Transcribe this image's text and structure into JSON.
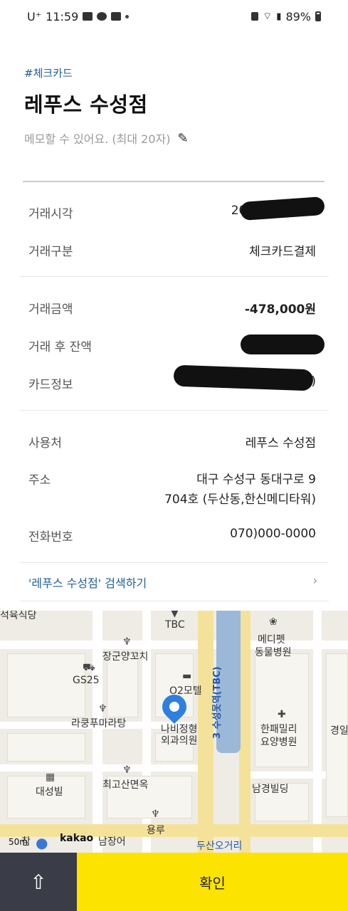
{
  "status_bar": {
    "carrier": "U⁺",
    "time": "11:59",
    "battery": "89%"
  },
  "header": {
    "tag": "#체크카드",
    "title": "레푸스 수성점",
    "memo_placeholder": "메모할 수 있어요. (최대 20자)"
  },
  "section1": [
    {
      "label": "거래시각",
      "value": "2021.08.2 :57"
    },
    {
      "label": "거래구분",
      "value": "체크카드결제"
    }
  ],
  "section2": [
    {
      "label": "거래금액",
      "value": "-478,000원"
    },
    {
      "label": "거래 후 잔액",
      "value": ""
    },
    {
      "label": "카드정보",
      "value": ")"
    }
  ],
  "section3": [
    {
      "label": "사용처",
      "value": "레푸스 수성점"
    },
    {
      "label": "주소",
      "value_line1": "대구 수성구 동대구로 9",
      "value_line2": "704호 (두산동,한신메디타워)"
    },
    {
      "label": "전화번호",
      "value": "070)000-0000"
    }
  ],
  "search_link": "'레푸스 수성점' 검색하기",
  "map": {
    "labels": {
      "tbc": "TBC",
      "medipet": "메디펫",
      "hospital_animal": "동물병원",
      "janggun": "장군양꼬치",
      "gs25": "GS25",
      "o2motel": "O2모텔",
      "station": "3 수성못역(TBC)",
      "lakung": "라쿵푸마라탕",
      "naejung": "나비정형",
      "surgery": "외과의원",
      "hanfamily": "한패밀리",
      "nursing": "요양병원",
      "gyeongil": "경일",
      "choigo": "최고산면옥",
      "daesung": "대성빌",
      "namgyung": "남경빌딩",
      "yongru": "용루",
      "doosan": "두산오거리",
      "sukyuk": "석육식당",
      "chamsushi": "참",
      "jangeo": "남장어",
      "scale": "50m",
      "kakao": "kakao"
    }
  },
  "bottom": {
    "confirm": "확인"
  }
}
